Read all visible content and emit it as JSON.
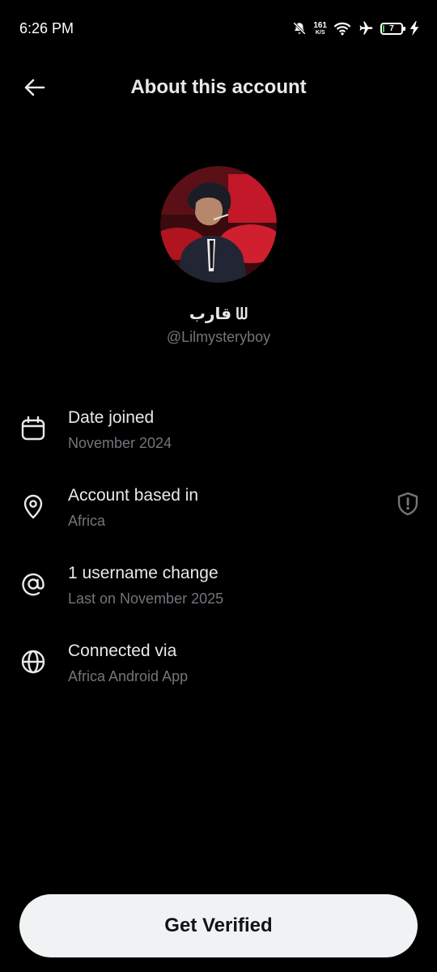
{
  "status_bar": {
    "time": "6:26 PM",
    "net_speed_value": "161",
    "net_speed_unit": "K/S",
    "battery_level": "7",
    "battery_fraction": 0.07,
    "battery_fill_color": "#3ec95a",
    "icons": [
      "mute-bell-icon",
      "wifi-icon",
      "airplane-icon",
      "battery-icon",
      "charging-bolt-icon"
    ]
  },
  "header": {
    "title": "About this account",
    "back_icon": "arrow-left-icon"
  },
  "profile": {
    "display_name": "قارب ᗯ",
    "username": "@Lilmysteryboy"
  },
  "info": [
    {
      "icon": "calendar-icon",
      "title": "Date joined",
      "subtitle": "November 2024"
    },
    {
      "icon": "location-pin-icon",
      "title": "Account based in",
      "subtitle": "Africa",
      "action_icon": "shield-alert-icon"
    },
    {
      "icon": "at-sign-icon",
      "title": "1 username change",
      "subtitle": "Last on November 2025"
    },
    {
      "icon": "globe-icon",
      "title": "Connected via",
      "subtitle": "Africa Android App"
    }
  ],
  "cta": {
    "label": "Get Verified"
  },
  "colors": {
    "background": "#000000",
    "primary_text": "#e7e9ea",
    "secondary_text": "#71767b",
    "button_background": "#eff3f4",
    "button_text": "#0f1419"
  }
}
